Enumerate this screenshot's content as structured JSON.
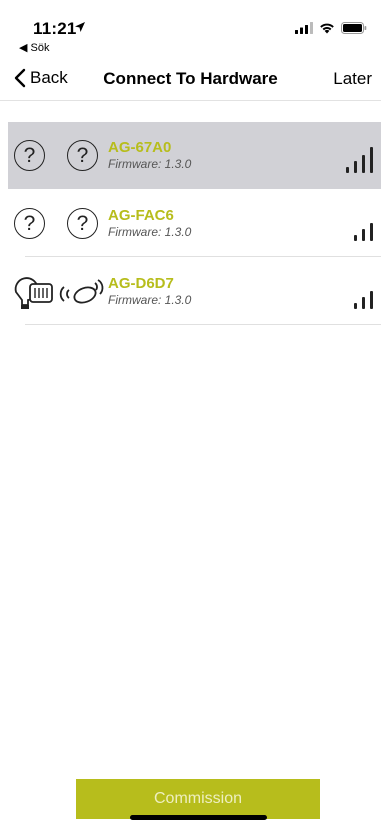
{
  "status_bar": {
    "time": "11:21",
    "back_app": "◀ Sök",
    "icons": [
      "location-arrow-icon",
      "cellular-signal-icon",
      "wifi-icon",
      "battery-icon"
    ]
  },
  "nav": {
    "back_label": "Back",
    "title": "Connect To Hardware",
    "later_label": "Later"
  },
  "devices": [
    {
      "name": "AG-67A0",
      "firmware": "Firmware: 1.3.0",
      "selected": true,
      "icon_type": "unknown",
      "signal_bars": 4
    },
    {
      "name": "AG-FAC6",
      "firmware": "Firmware: 1.3.0",
      "selected": false,
      "icon_type": "unknown",
      "signal_bars": 3
    },
    {
      "name": "AG-D6D7",
      "firmware": "Firmware: 1.3.0",
      "selected": false,
      "icon_type": "bulb-and-sensor",
      "signal_bars": 3
    }
  ],
  "commission_label": "Commission",
  "colors": {
    "accent": "#b7bd1c",
    "selected_row": "#d1d1d6"
  }
}
